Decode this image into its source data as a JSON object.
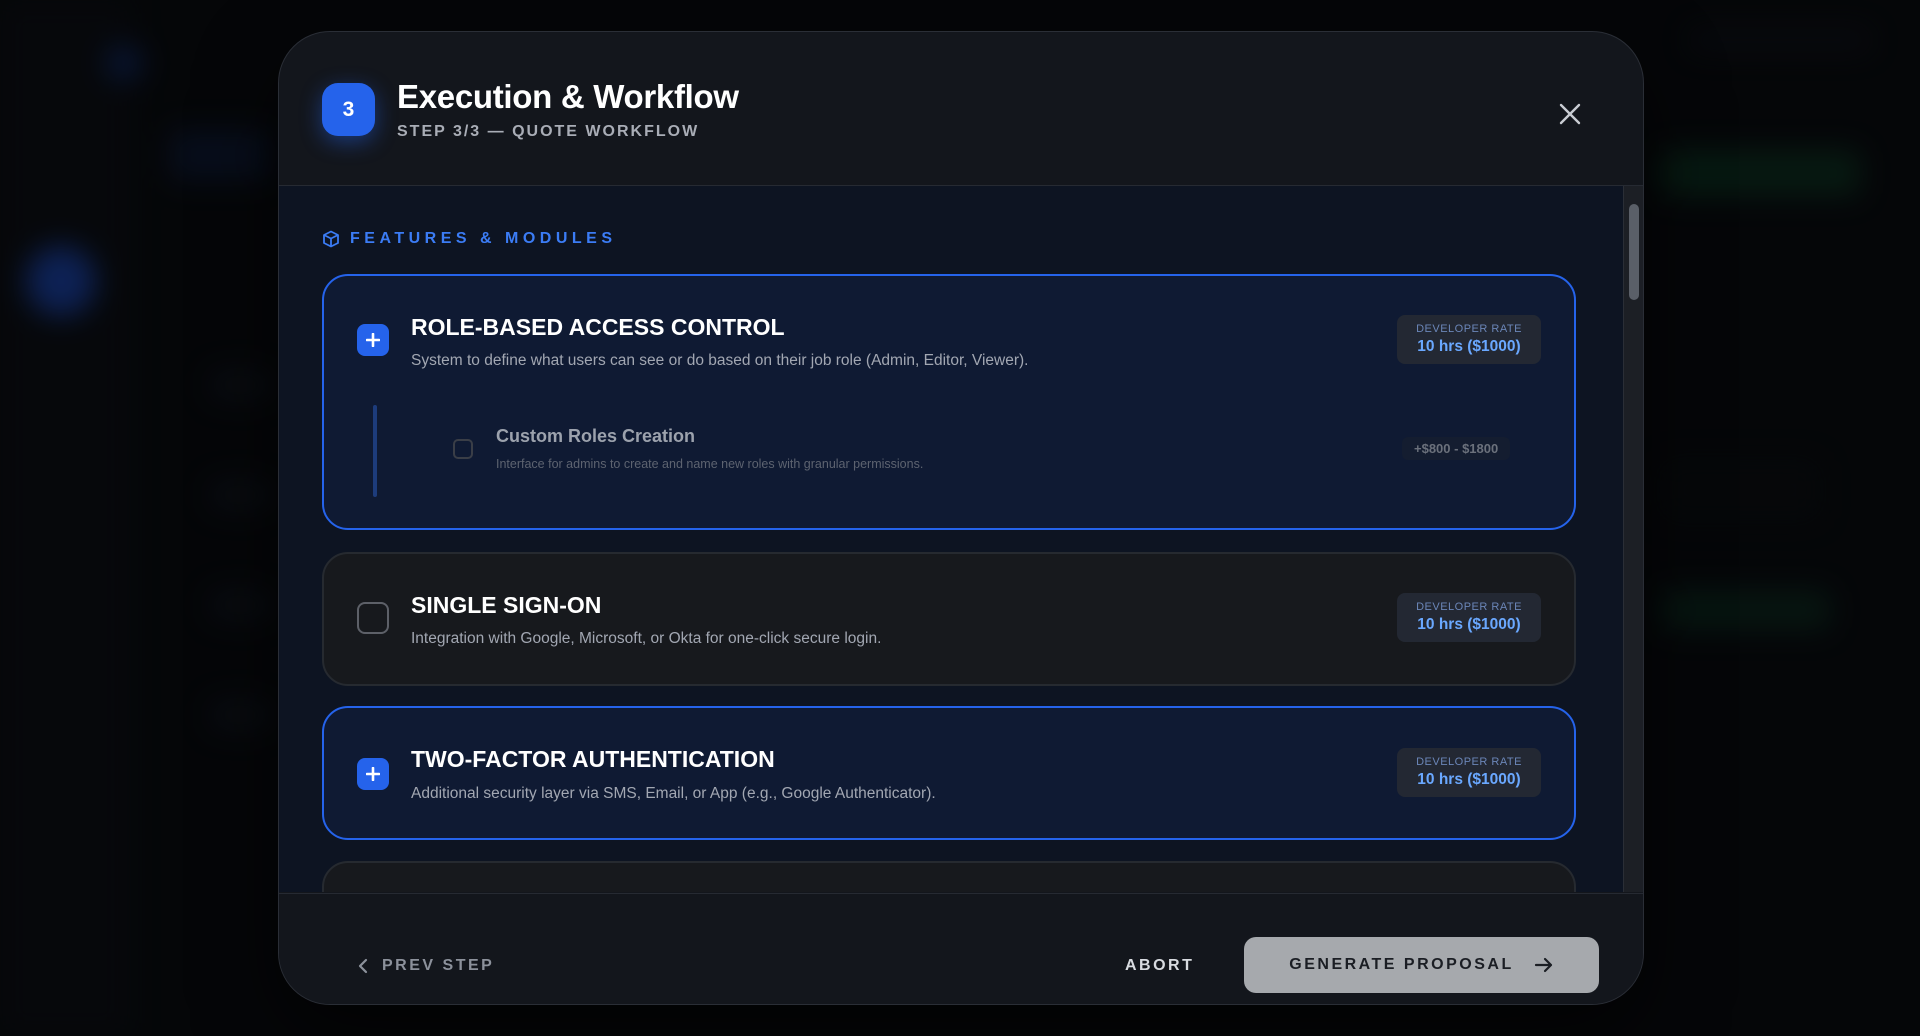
{
  "modal": {
    "step_number": "3",
    "title": "Execution & Workflow",
    "subtitle": "STEP 3/3 — QUOTE WORKFLOW",
    "close_icon": "close-icon"
  },
  "section": {
    "label": "FEATURES & MODULES",
    "icon": "cube-icon",
    "accent_color": "#3b7cf5"
  },
  "features": [
    {
      "title": "ROLE-BASED ACCESS CONTROL",
      "description": "System to define what users can see or do based on their job role (Admin, Editor, Viewer).",
      "selected": true,
      "rate_label": "DEVELOPER RATE",
      "rate_value": "10 hrs ($1000)",
      "sub_options": [
        {
          "title": "Custom Roles Creation",
          "description": "Interface for admins to create and name new roles with granular permissions.",
          "price": "+$800 - $1800",
          "selected": false
        }
      ]
    },
    {
      "title": "SINGLE SIGN-ON",
      "description": "Integration with Google, Microsoft, or Okta for one-click secure login.",
      "selected": false,
      "rate_label": "DEVELOPER RATE",
      "rate_value": "10 hrs ($1000)"
    },
    {
      "title": "TWO-FACTOR AUTHENTICATION",
      "description": "Additional security layer via SMS, Email, or App (e.g., Google Authenticator).",
      "selected": true,
      "rate_label": "DEVELOPER RATE",
      "rate_value": "10 hrs ($1000)"
    }
  ],
  "footer": {
    "prev_label": "PREV STEP",
    "abort_label": "ABORT",
    "generate_label": "GENERATE PROPOSAL"
  },
  "colors": {
    "primary": "#2563eb",
    "modal_bg": "#13161c",
    "body_bg": "#0d1422"
  }
}
